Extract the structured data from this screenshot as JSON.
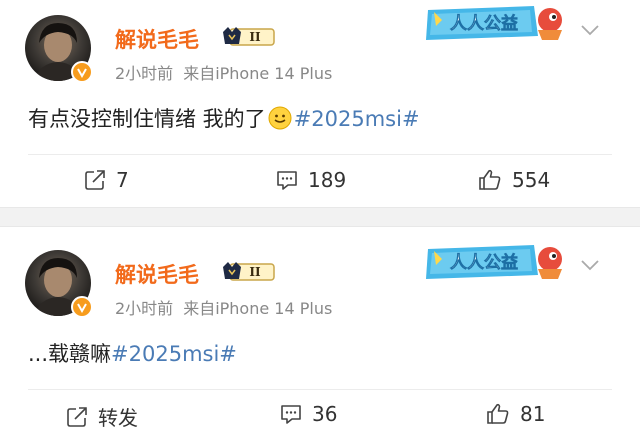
{
  "colors": {
    "username": "#f26a1b",
    "hashtag": "#4a7bb5",
    "meta": "#888888",
    "verified": "#f79c1d"
  },
  "posts": [
    {
      "author": "解说毛毛",
      "level_badge": "II",
      "time": "2小时前",
      "source": "来自iPhone 14 Plus",
      "charity_label": "人人公益",
      "text": "有点没控制住情绪 我的了",
      "emoji": "smile-emoji",
      "hashtag": "#2025msi#",
      "repost_label": "7",
      "comment_count": "189",
      "like_count": "554"
    },
    {
      "author": "解说毛毛",
      "level_badge": "II",
      "time": "2小时前",
      "source": "来自iPhone 14 Plus",
      "charity_label": "人人公益",
      "text": "...载赣嘛",
      "hashtag": "#2025msi#",
      "repost_label": "转发",
      "comment_count": "36",
      "like_count": "81"
    }
  ]
}
